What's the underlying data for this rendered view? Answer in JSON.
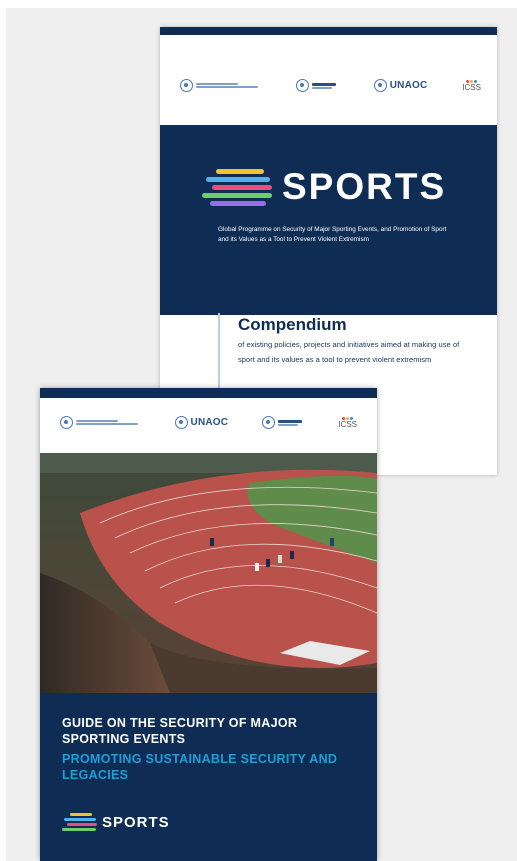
{
  "compendium_cover": {
    "logos": {
      "un_office_name": "",
      "unicri_label": "",
      "unaoc_label": "UNAOC",
      "icss_label": "ICSS"
    },
    "sports_label": "SPORTS",
    "programme_text": "Global Programme on Security of Major Sporting Events, and Promotion of Sport and its Values as a Tool to Prevent Violent Extremism",
    "title": "Compendium",
    "subtitle": "of existing policies, projects and initiatives aimed at making use of sport and its values as a tool to prevent violent extremism"
  },
  "guide_cover": {
    "logos": {
      "un_office_name": "",
      "unaoc_label": "UNAOC",
      "unicri_label": "",
      "icss_label": "ICSS"
    },
    "title": "GUIDE ON THE SECURITY OF MAJOR SPORTING EVENTS",
    "subtitle": "PROMOTING SUSTAINABLE SECURITY AND LEGACIES",
    "sports_label": "SPORTS"
  },
  "colors": {
    "navy": "#0f2d54",
    "accent_blue": "#1d9fd8",
    "logo_blue": "#4a78b5",
    "track_red": "#b8524a"
  },
  "icons": [
    "un-emblem-icon",
    "sports-speed-lines-icon",
    "icss-dots-icon"
  ]
}
